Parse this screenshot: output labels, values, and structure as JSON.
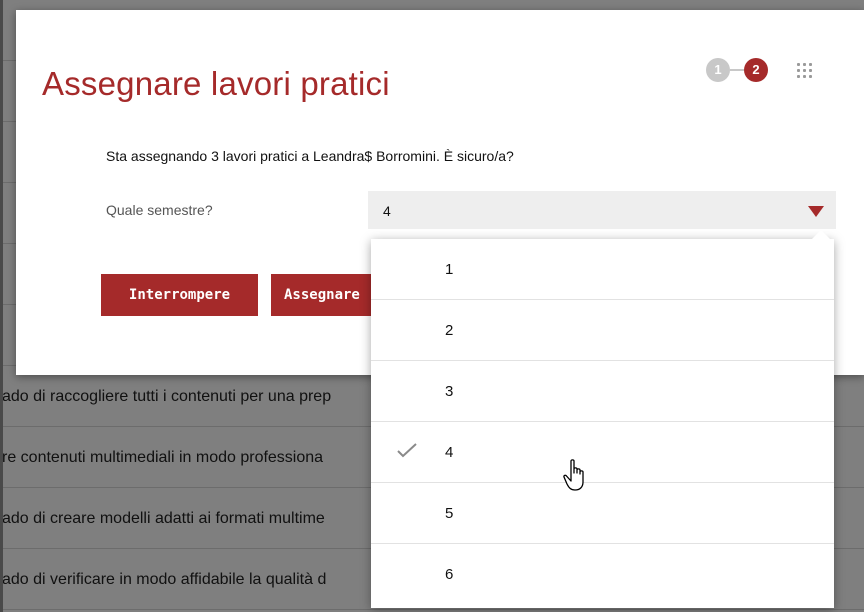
{
  "background": {
    "rows": [
      "ado di raccogliere tutti i contenuti per una prep",
      "re contenuti multimediali in modo professiona",
      "ado di creare modelli adatti ai formati multime",
      "ado di verificare in modo affidabile la qualità d"
    ]
  },
  "dialog": {
    "title": "Assegnare lavori pratici",
    "steps": [
      "1",
      "2"
    ],
    "current_step": 2,
    "confirm_text": "Sta assegnando 3 lavori pratici a Leandra$ Borromini. È sicuro/a?",
    "semester_label": "Quale semestre?",
    "semester_value": "4",
    "cancel_label": "Interrompere",
    "assign_label": "Assegnare"
  },
  "menu": {
    "options": [
      "1",
      "2",
      "3",
      "4",
      "5",
      "6"
    ],
    "selected": "4"
  },
  "colors": {
    "accent": "#a52a2a",
    "step_inactive": "#c8c8c8",
    "select_bg": "#eeeeee"
  },
  "icons": [
    "grid-icon",
    "caret-down-icon",
    "check-icon",
    "hand-pointer-icon"
  ]
}
